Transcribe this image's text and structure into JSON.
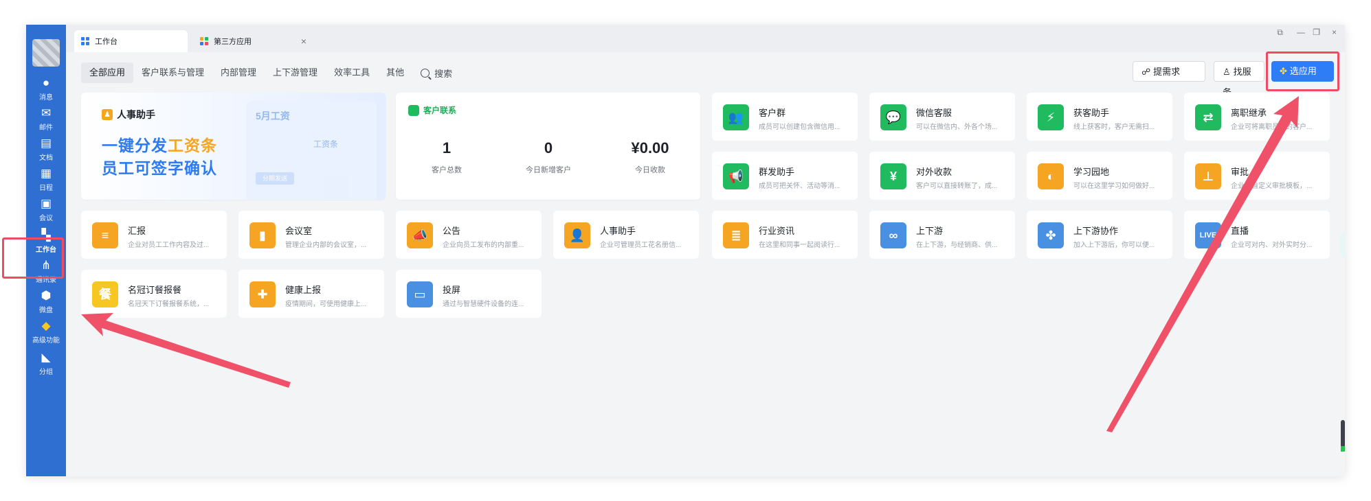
{
  "tabs": [
    {
      "label": "工作台",
      "active": true
    },
    {
      "label": "第三方应用",
      "active": false
    }
  ],
  "window_controls": {
    "close": "×",
    "minimize": "—",
    "restore": "❐"
  },
  "sidebar": {
    "items": [
      {
        "label": "消息",
        "icon": "message-icon"
      },
      {
        "label": "邮件",
        "icon": "mail-icon"
      },
      {
        "label": "文档",
        "icon": "doc-icon"
      },
      {
        "label": "日程",
        "icon": "calendar-icon"
      },
      {
        "label": "会议",
        "icon": "meeting-icon"
      },
      {
        "label": "工作台",
        "icon": "workbench-icon",
        "active": true
      },
      {
        "label": "通讯录",
        "icon": "contacts-icon"
      },
      {
        "label": "微盘",
        "icon": "drive-icon"
      },
      {
        "label": "高级功能",
        "icon": "advanced-icon"
      },
      {
        "label": "分组",
        "icon": "group-icon"
      }
    ]
  },
  "categories": [
    "全部应用",
    "客户联系与管理",
    "内部管理",
    "上下游管理",
    "效率工具",
    "其他"
  ],
  "search_label": "搜索",
  "top_buttons": {
    "request": "提需求",
    "service": "找服务",
    "choose": "选应用"
  },
  "banner": {
    "title": "人事助手",
    "line1_a": "一键分发",
    "line1_b": "工资条",
    "line2": "员工可签字确认",
    "phone_month": "5月工资",
    "phone_slip": "工资条",
    "phone_btn": "分期发送"
  },
  "customer": {
    "title": "客户联系",
    "stats": [
      {
        "value": "1",
        "label": "客户总数"
      },
      {
        "value": "0",
        "label": "今日新增客户"
      },
      {
        "value": "¥0.00",
        "label": "今日收款"
      }
    ]
  },
  "apps": [
    {
      "name": "客户群",
      "desc": "成员可以创建包含微信用...",
      "color": "#1fbb5e",
      "glyph": "👥"
    },
    {
      "name": "微信客服",
      "desc": "可以在微信内、外各个场...",
      "color": "#1fbb5e",
      "glyph": "💬"
    },
    {
      "name": "获客助手",
      "desc": "线上获客时，客户无需扫...",
      "color": "#1fbb5e",
      "glyph": "⚡"
    },
    {
      "name": "离职继承",
      "desc": "企业可将离职员工的客户...",
      "color": "#1fbb5e",
      "glyph": "⇄"
    },
    {
      "name": "群发助手",
      "desc": "成员可把关怀、活动等消...",
      "color": "#1fbb5e",
      "glyph": "📢"
    },
    {
      "name": "对外收款",
      "desc": "客户可以直接转账了，成...",
      "color": "#1fbb5e",
      "glyph": "¥"
    },
    {
      "name": "学习园地",
      "desc": "可以在这里学习如何做好...",
      "color": "#f6a523",
      "glyph": "◐"
    },
    {
      "name": "审批",
      "desc": "企业可自定义审批模板，...",
      "color": "#f6a523",
      "glyph": "⊥"
    },
    {
      "name": "汇报",
      "desc": "企业对员工工作内容及过...",
      "color": "#f6a523",
      "glyph": "≡"
    },
    {
      "name": "会议室",
      "desc": "管理企业内部的会议室，...",
      "color": "#f6a523",
      "glyph": "▮"
    },
    {
      "name": "公告",
      "desc": "企业向员工发布的内部重...",
      "color": "#f6a523",
      "glyph": "📣"
    },
    {
      "name": "人事助手",
      "desc": "企业可管理员工花名册信...",
      "color": "#f6a523",
      "glyph": "👤"
    },
    {
      "name": "行业资讯",
      "desc": "在这里和同事一起阅读行...",
      "color": "#f6a523",
      "glyph": "≣"
    },
    {
      "name": "上下游",
      "desc": "在上下游，与经销商、供...",
      "color": "#4a90e2",
      "glyph": "∞"
    },
    {
      "name": "上下游协作",
      "desc": "加入上下游后，你可以便...",
      "color": "#4a90e2",
      "glyph": "✤"
    },
    {
      "name": "直播",
      "desc": "企业可对内、对外实时分...",
      "color": "#4a90e2",
      "glyph": "LIVE"
    },
    {
      "name": "名冠订餐报餐",
      "desc": "名冠天下订餐报餐系统，...",
      "color": "#f6c623",
      "glyph": "餐"
    },
    {
      "name": "健康上报",
      "desc": "疫情期间，可使用健康上...",
      "color": "#f6a523",
      "glyph": "✚"
    },
    {
      "name": "投屏",
      "desc": "通过与智慧硬件设备的连...",
      "color": "#4a90e2",
      "glyph": "▭"
    }
  ],
  "colors": {
    "sidebar": "#2f6fd1",
    "accent": "#2f7df6",
    "highlight": "#ef4b63"
  }
}
